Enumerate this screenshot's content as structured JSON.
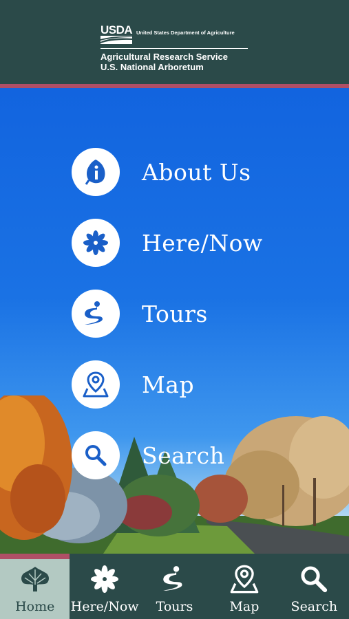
{
  "header": {
    "agency": "USDA",
    "department": "United States Department of Agriculture",
    "line1": "Agricultural Research Service",
    "line2": "U.S. National Arboretum"
  },
  "menu": {
    "items": [
      {
        "label": "About Us",
        "icon": "info-leaf-icon"
      },
      {
        "label": "Here/Now",
        "icon": "flower-icon"
      },
      {
        "label": "Tours",
        "icon": "path-icon"
      },
      {
        "label": "Map",
        "icon": "map-pin-icon"
      },
      {
        "label": "Search",
        "icon": "search-icon"
      }
    ]
  },
  "tabs": {
    "active": "Home",
    "items": [
      {
        "label": "Home",
        "icon": "tree-icon"
      },
      {
        "label": "Here/Now",
        "icon": "flower-icon"
      },
      {
        "label": "Tours",
        "icon": "path-icon"
      },
      {
        "label": "Map",
        "icon": "map-pin-icon"
      },
      {
        "label": "Search",
        "icon": "search-icon"
      }
    ]
  },
  "colors": {
    "header_bg": "#2b4a49",
    "accent_stripe": "#b04f66",
    "sky": "#1a6fe0",
    "icon_blue": "#1a5fc8",
    "active_tab_bg": "#b3c9c2"
  }
}
